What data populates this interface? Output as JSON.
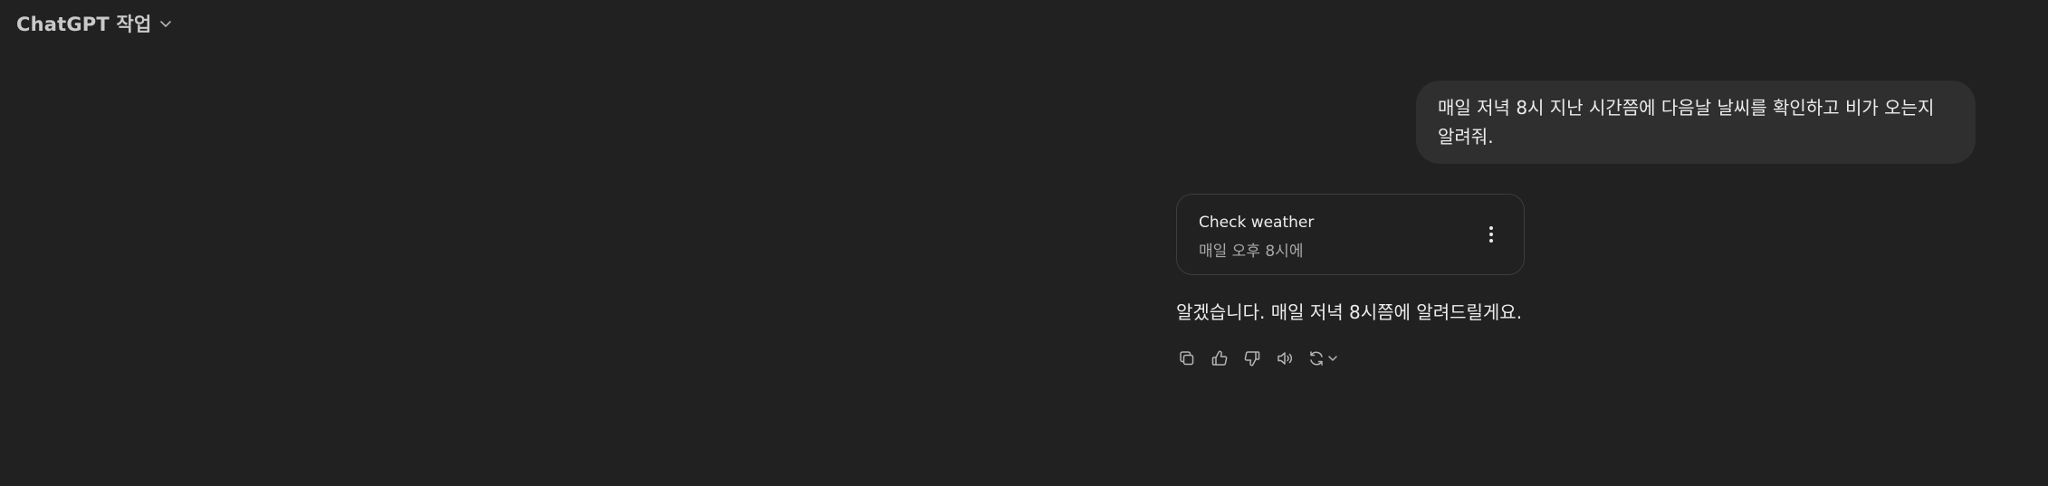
{
  "header": {
    "title": "ChatGPT 작업"
  },
  "conversation": {
    "user_message": "매일 저녁 8시 지난 시간쯤에 다음날 날씨를 확인하고 비가 오는지 알려줘.",
    "task_card": {
      "title": "Check weather",
      "schedule": "매일 오후 8시에"
    },
    "assistant_message": "알겠습니다. 매일 저녁 8시쯤에 알려드릴게요."
  },
  "icons": {
    "header_chevron": "chevron-down-icon",
    "task_menu": "more-vertical-icon",
    "copy": "copy-icon",
    "thumbs_up": "thumbs-up-icon",
    "thumbs_down": "thumbs-down-icon",
    "read_aloud": "speaker-icon",
    "regenerate": "refresh-icon"
  },
  "colors": {
    "background": "#212121",
    "user_bubble": "#2f2f2f",
    "text": "#ececec",
    "muted_text": "#a8a8a8",
    "card_border": "#3d3d3d"
  }
}
